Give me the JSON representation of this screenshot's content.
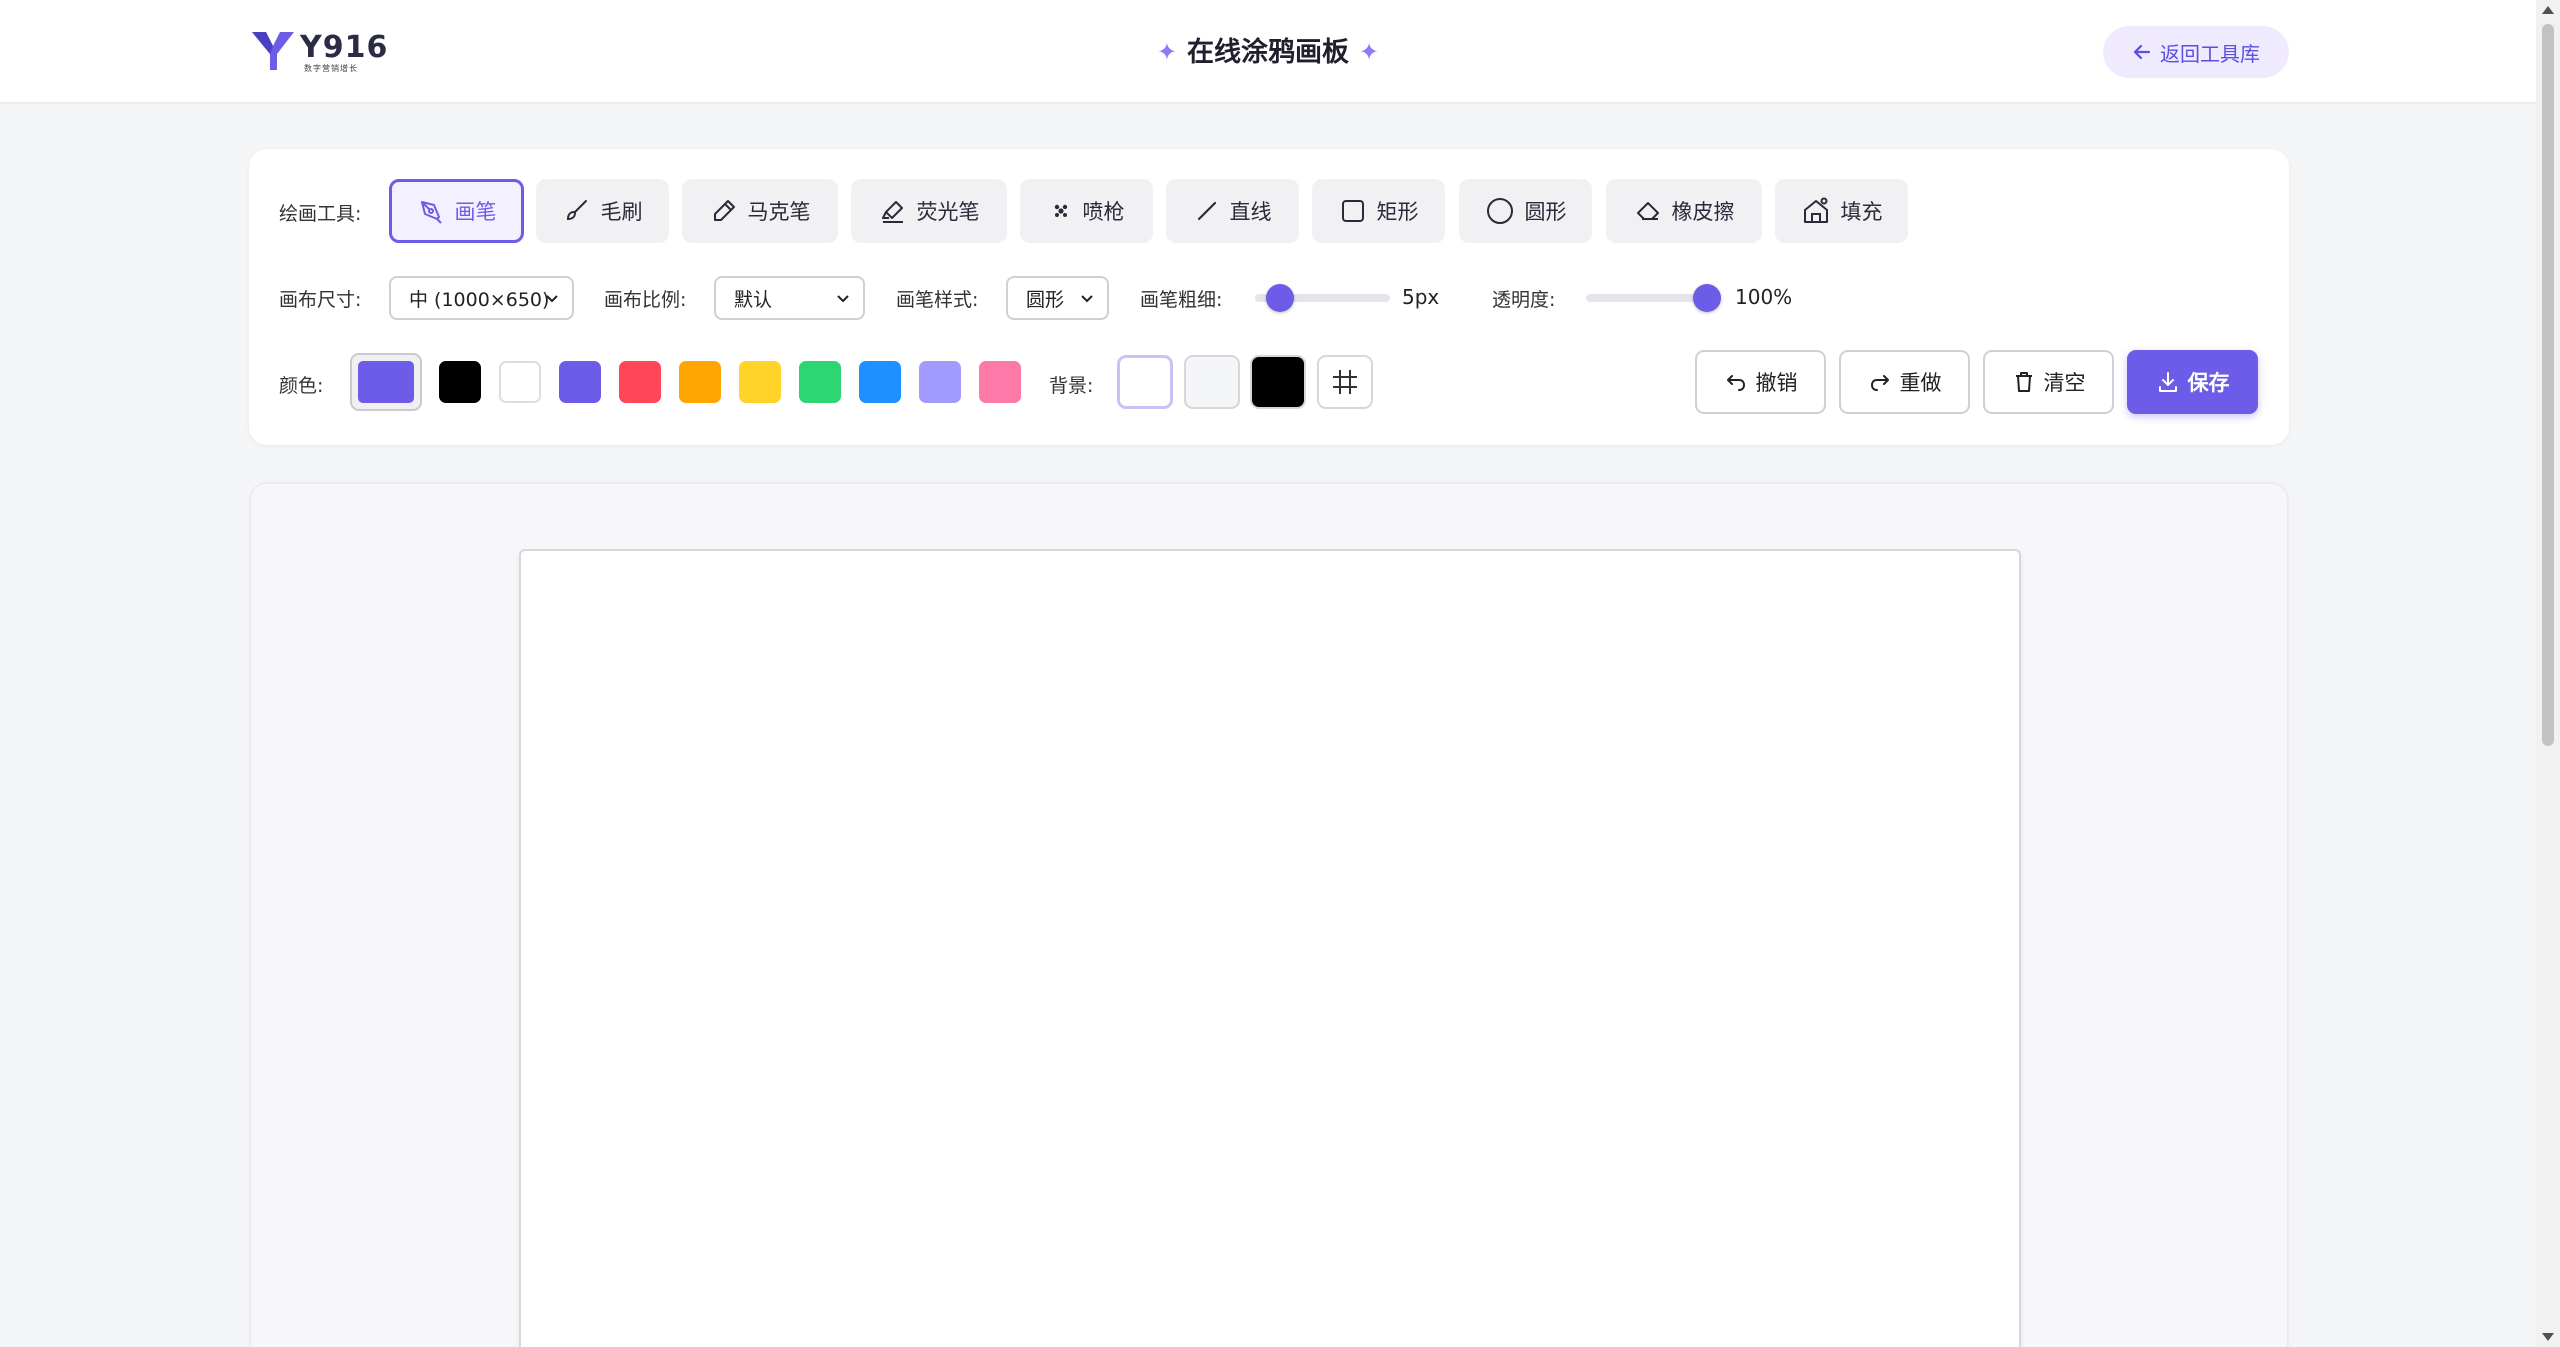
{
  "header": {
    "logo_text": "Y916",
    "logo_sub": "数字营销增长",
    "title": "在线涂鸦画板",
    "back_label": "返回工具库"
  },
  "tools": {
    "label": "绘画工具:",
    "items": [
      {
        "label": "画笔",
        "icon": "pen-icon",
        "active": true
      },
      {
        "label": "毛刷",
        "icon": "brush-icon"
      },
      {
        "label": "马克笔",
        "icon": "marker-icon"
      },
      {
        "label": "荧光笔",
        "icon": "highlighter-icon"
      },
      {
        "label": "喷枪",
        "icon": "spray-icon"
      },
      {
        "label": "直线",
        "icon": "line-icon"
      },
      {
        "label": "矩形",
        "icon": "rectangle-icon"
      },
      {
        "label": "圆形",
        "icon": "circle-icon"
      },
      {
        "label": "橡皮擦",
        "icon": "eraser-icon"
      },
      {
        "label": "填充",
        "icon": "fill-bucket-icon"
      }
    ]
  },
  "settings": {
    "canvas_size_label": "画布尺寸:",
    "canvas_size_value": "中 (1000×650)",
    "canvas_ratio_label": "画布比例:",
    "canvas_ratio_value": "默认",
    "brush_style_label": "画笔样式:",
    "brush_style_value": "圆形",
    "brush_width_label": "画笔粗细:",
    "brush_width_value": "5px",
    "brush_width_level": 0.1,
    "opacity_label": "透明度:",
    "opacity_value": "100%",
    "opacity_level": 1.0
  },
  "colors": {
    "label": "颜色:",
    "current": "#6c5ce7",
    "palette": [
      "#000000",
      "#ffffff",
      "#6c5ce7",
      "#ff4757",
      "#ffa502",
      "#ffd32a",
      "#2ed573",
      "#1e90ff",
      "#a29bfe",
      "#fd79a8"
    ]
  },
  "background": {
    "label": "背景:",
    "options": [
      "#ffffff",
      "#f4f5f7",
      "#000000",
      "grid"
    ]
  },
  "actions": {
    "undo": "撤销",
    "redo": "重做",
    "clear": "清空",
    "save": "保存"
  }
}
